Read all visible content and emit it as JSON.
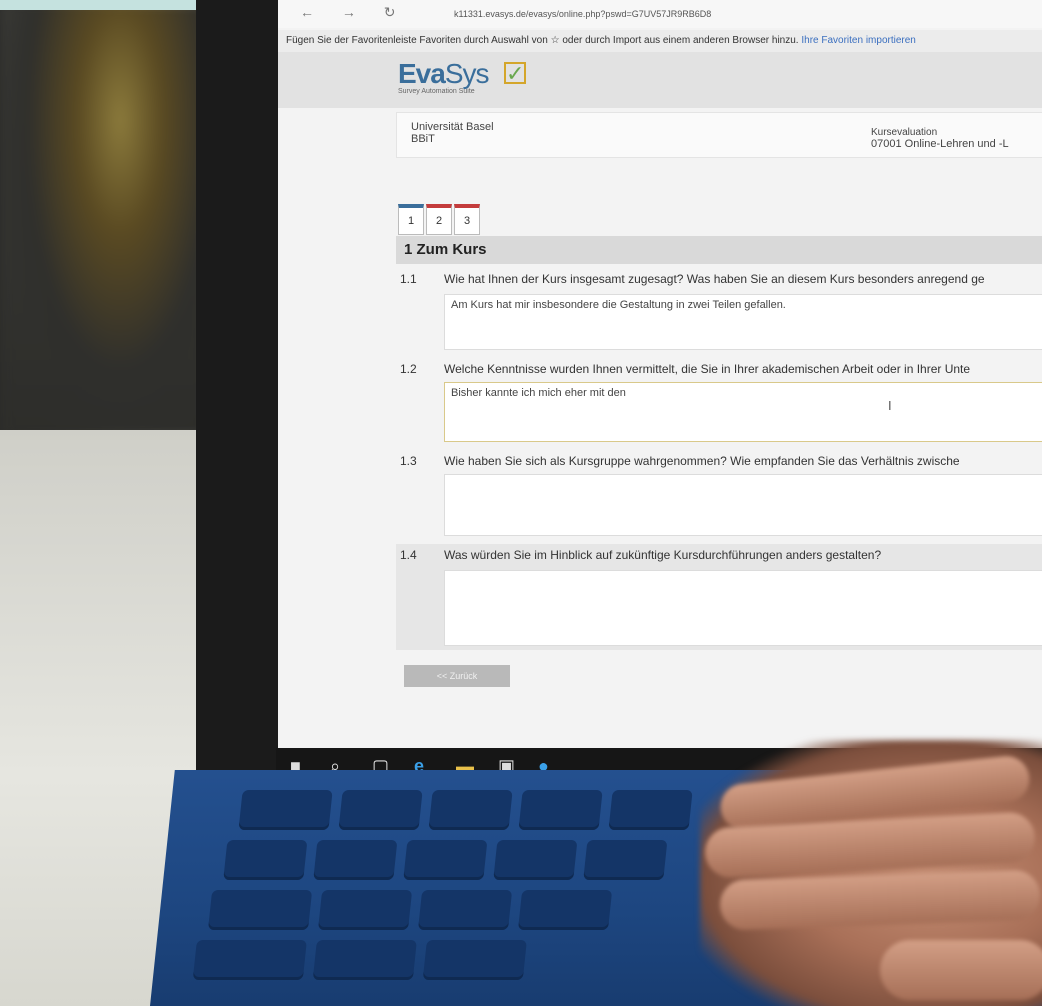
{
  "browser": {
    "nav": "← → ↻",
    "url": "k11331.evasys.de/evasys/online.php?pswd=G7UV57JR9RB6D8",
    "favorites_text": "Fügen Sie der Favoritenleiste Favoriten durch Auswahl von ☆ oder durch Import aus einem anderen Browser hinzu.",
    "favorites_link": "Ihre Favoriten importieren"
  },
  "header": {
    "logo_eva": "Eva",
    "logo_sys": "Sys",
    "tagline": "Survey Automation Suite"
  },
  "info": {
    "institution": "Universität Basel",
    "unit": "BBiT",
    "type": "Kursevaluation",
    "course": "07001 Online-Lehren und -L"
  },
  "tabs": [
    "1",
    "2",
    "3"
  ],
  "section": {
    "title": "1  Zum Kurs"
  },
  "questions": [
    {
      "num": "1.1",
      "text": "Wie hat Ihnen der Kurs insgesamt zugesagt? Was haben Sie an diesem Kurs besonders anregend ge",
      "answer": "Am Kurs hat mir insbesondere die Gestaltung in zwei Teilen gefallen."
    },
    {
      "num": "1.2",
      "text": "Welche Kenntnisse wurden Ihnen vermittelt, die Sie in Ihrer akademischen Arbeit oder in Ihrer Unte",
      "answer": "Bisher kannte ich mich eher mit den"
    },
    {
      "num": "1.3",
      "text": "Wie haben Sie sich als Kursgruppe wahrgenommen? Wie empfanden Sie das Verhältnis zwische",
      "answer": ""
    },
    {
      "num": "1.4",
      "text": "Was würden Sie im Hinblick auf zukünftige Kursdurchführungen anders gestalten?",
      "answer": ""
    }
  ],
  "buttons": {
    "back": "<< Zurück"
  },
  "taskbar": {
    "icons": [
      "windows-icon",
      "search-icon",
      "task-view-icon",
      "edge-icon",
      "file-explorer-icon",
      "store-icon",
      "skype-icon"
    ]
  },
  "colors": {
    "evasys_blue": "#3a6e9b",
    "tab_red": "#c43c3c",
    "keyboard_blue": "#1d4680"
  }
}
